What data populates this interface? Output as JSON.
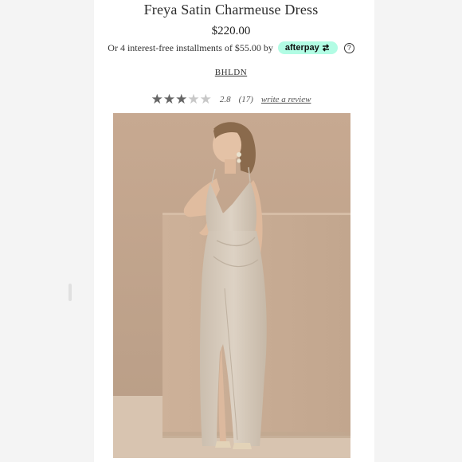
{
  "product": {
    "title": "Freya Satin Charmeuse Dress",
    "price": "$220.00",
    "installments_text": "Or 4 interest-free installments of $55.00 by",
    "afterpay_label": "afterpay",
    "help_glyph": "?",
    "brand": "BHLDN"
  },
  "rating": {
    "value": "2.8",
    "stars_filled": 3,
    "stars_total": 5,
    "count": "(17)",
    "review_link": "write a review"
  },
  "colors": {
    "afterpay_mint": "#b2fce4",
    "star_filled": "#666666",
    "star_empty": "#c8c8c8",
    "photo_backdrop": "#c9ab91",
    "dress": "#d2c6b6"
  },
  "icons": {
    "help": "question-circle-icon",
    "afterpay_arrow": "afterpay-arrows-icon",
    "star": "star-icon"
  }
}
